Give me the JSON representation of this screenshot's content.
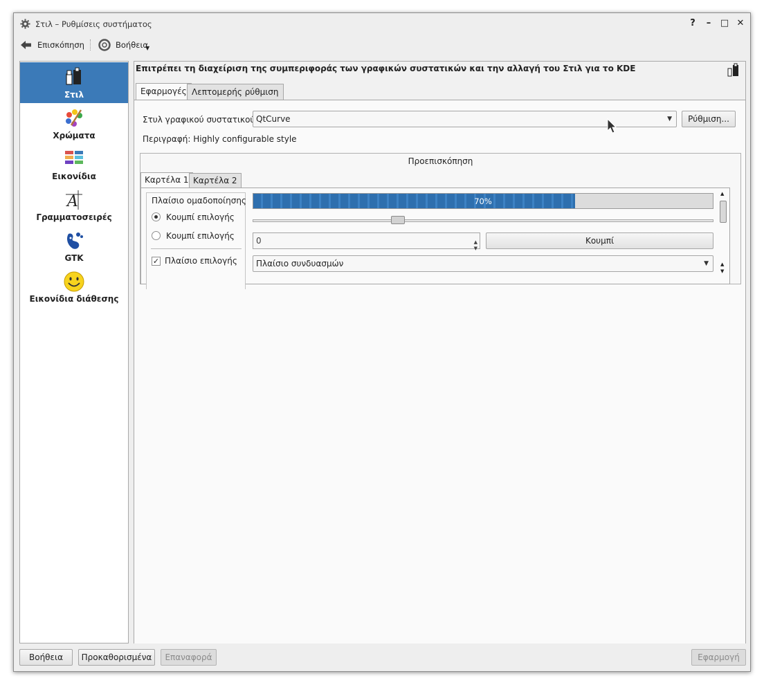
{
  "window": {
    "title": "Στιλ – Ρυθμίσεις συστήματος"
  },
  "window_controls": {
    "help": "?",
    "minimize": "–",
    "maximize": "□",
    "close": "✕"
  },
  "toolbar": {
    "overview_label": "Επισκόπηση",
    "help_label": "Βοήθεια"
  },
  "sidebar": {
    "items": [
      {
        "label": "Στιλ",
        "icon": "style-icon",
        "active": true
      },
      {
        "label": "Χρώματα",
        "icon": "colors-icon"
      },
      {
        "label": "Εικονίδια",
        "icon": "icons-icon"
      },
      {
        "label": "Γραμματοσειρές",
        "icon": "fonts-icon"
      },
      {
        "label": "GTK",
        "icon": "gtk-icon"
      },
      {
        "label": "Εικονίδια διάθεσης",
        "icon": "emoticons-icon"
      }
    ]
  },
  "main": {
    "heading": "Επιτρέπει τη διαχείριση της συμπεριφοράς των γραφικών συστατικών και την αλλαγή του Στιλ για το KDE",
    "tabs": [
      "Εφαρμογές",
      "Λεπτομερής ρύθμιση"
    ],
    "widget_style_label": "Στυλ γραφικού συστατικού:",
    "widget_style_value": "QtCurve",
    "configure_button": "Ρύθμιση...",
    "description": "Περιγραφή: Highly configurable style"
  },
  "preview": {
    "title": "Προεπισκόπηση",
    "tabs": [
      "Καρτέλα 1",
      "Καρτέλα 2"
    ],
    "groupbox_title": "Πλαίσιο ομαδοποίησης",
    "radio1": "Κουμπί επιλογής",
    "radio2": "Κουμπί επιλογής",
    "checkbox": "Πλαίσιο επιλογής",
    "progress_text": "70%",
    "progress_value": 0.7,
    "slider_value": 0.31,
    "spin_value": "0",
    "button": "Κουμπί",
    "combo": "Πλαίσιο συνδυασμών"
  },
  "footer": {
    "help": "Βοήθεια",
    "defaults": "Προκαθορισμένα",
    "reset": "Επαναφορά",
    "apply": "Εφαρμογή"
  },
  "colors": {
    "accent": "#3b7ab8",
    "progress": "#2e6fae"
  }
}
